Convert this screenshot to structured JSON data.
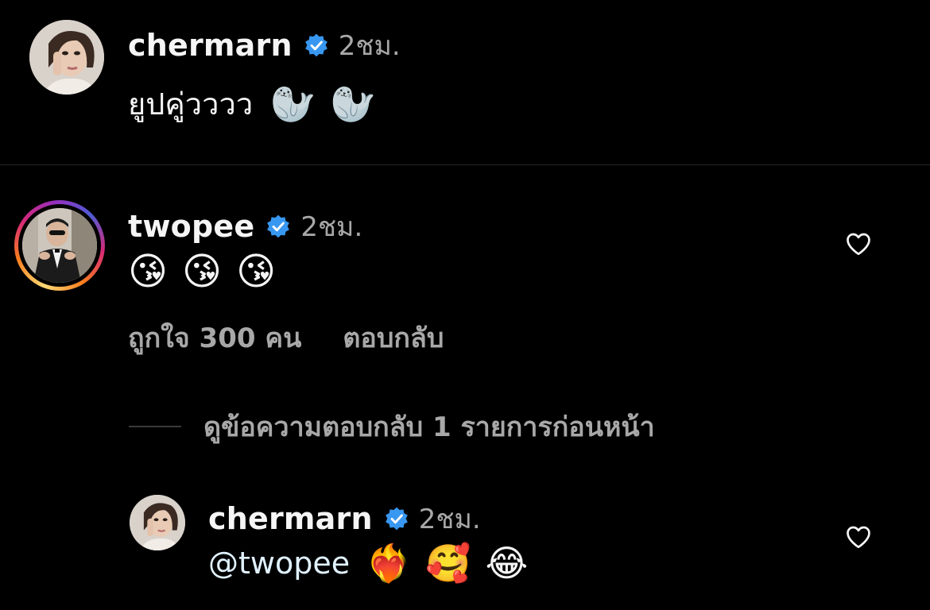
{
  "caption": {
    "username": "chermarn",
    "timestamp": "2ชม.",
    "text": "ยูปคู่วววว",
    "emojis": [
      "🦭",
      "🦭"
    ]
  },
  "comment": {
    "username": "twopee",
    "timestamp": "2ชม.",
    "emojis": [
      "😘",
      "😘",
      "😘"
    ],
    "likes_label": "ถูกใจ 300 คน",
    "reply_label": "ตอบกลับ",
    "view_replies_label": "ดูข้อความตอบกลับ 1 รายการก่อนหน้า"
  },
  "reply": {
    "username": "chermarn",
    "timestamp": "2ชม.",
    "mention": "@twopee",
    "emojis": [
      "❤️‍🔥",
      "🥰",
      "😂"
    ]
  },
  "colors": {
    "background": "#000000",
    "text_primary": "#f5f5f5",
    "text_secondary": "#a8a8a8",
    "verified_blue": "#3897f0",
    "mention": "#e0f1ff"
  },
  "icons": {
    "verified": "verified-badge-icon",
    "like": "heart-outline-icon"
  }
}
